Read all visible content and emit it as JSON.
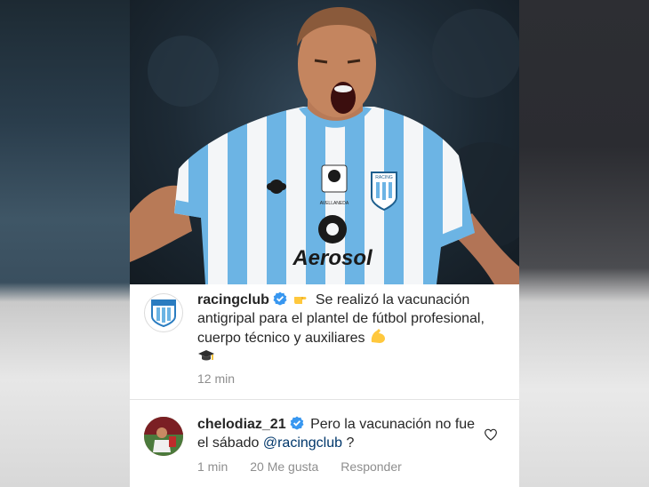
{
  "post": {
    "username": "racingclub",
    "caption": "Se realizó la vacunación antigripal para el plantel de fútbol profesional, cuerpo técnico y auxiliares",
    "time": "12 min",
    "photo_text": {
      "sponsor": "Aerosol",
      "brand": "Kappa",
      "crest_text": "RACING",
      "patch_text": "AVELLANEDA"
    }
  },
  "comment": {
    "username": "chelodiaz_21",
    "text": "Pero la vacunación no fue el sábado",
    "mention": "@racingclub",
    "suffix": " ?",
    "time": "1 min",
    "likes": "20 Me gusta",
    "reply_label": "Responder"
  },
  "icons": {
    "verified": "verified-badge-icon",
    "pointing": "backhand-index-pointing-right-emoji",
    "flexed": "flexed-biceps-emoji",
    "cap": "graduation-cap-emoji",
    "heart": "heart-outline-icon"
  },
  "colors": {
    "verified": "#3897f0",
    "text": "#262626",
    "meta": "#8e8e8e",
    "mention": "#00376b",
    "racing_blue": "#6cb4e4"
  }
}
